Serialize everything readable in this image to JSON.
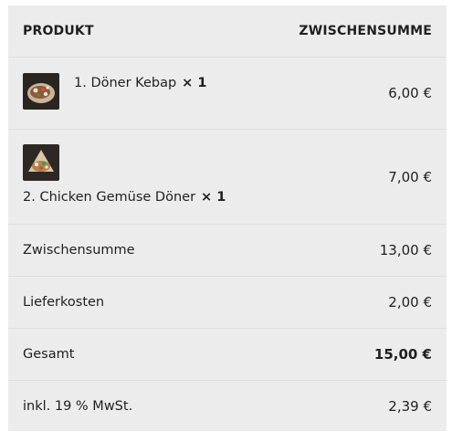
{
  "table": {
    "header": {
      "product": "PRODUKT",
      "subtotal": "ZWISCHENSUMME"
    },
    "items": [
      {
        "name": "1. Döner Kebap",
        "qty": "× 1",
        "price": "6,00 €",
        "image_icon": "doner-kebap-thumbnail"
      },
      {
        "name": "2. Chicken Gemüse Döner",
        "qty": "× 1",
        "price": "7,00 €",
        "image_icon": "chicken-doner-thumbnail"
      }
    ],
    "summary": [
      {
        "label": "Zwischensumme",
        "value": "13,00 €"
      },
      {
        "label": "Lieferkosten",
        "value": "2,00 €"
      },
      {
        "label": "Gesamt",
        "value": "15,00 €"
      },
      {
        "label": "inkl. 19 % MwSt.",
        "value": "2,39 €"
      }
    ]
  },
  "colors": {
    "background": "#ececec",
    "divider": "#dedede",
    "text": "#1f1f1f"
  }
}
